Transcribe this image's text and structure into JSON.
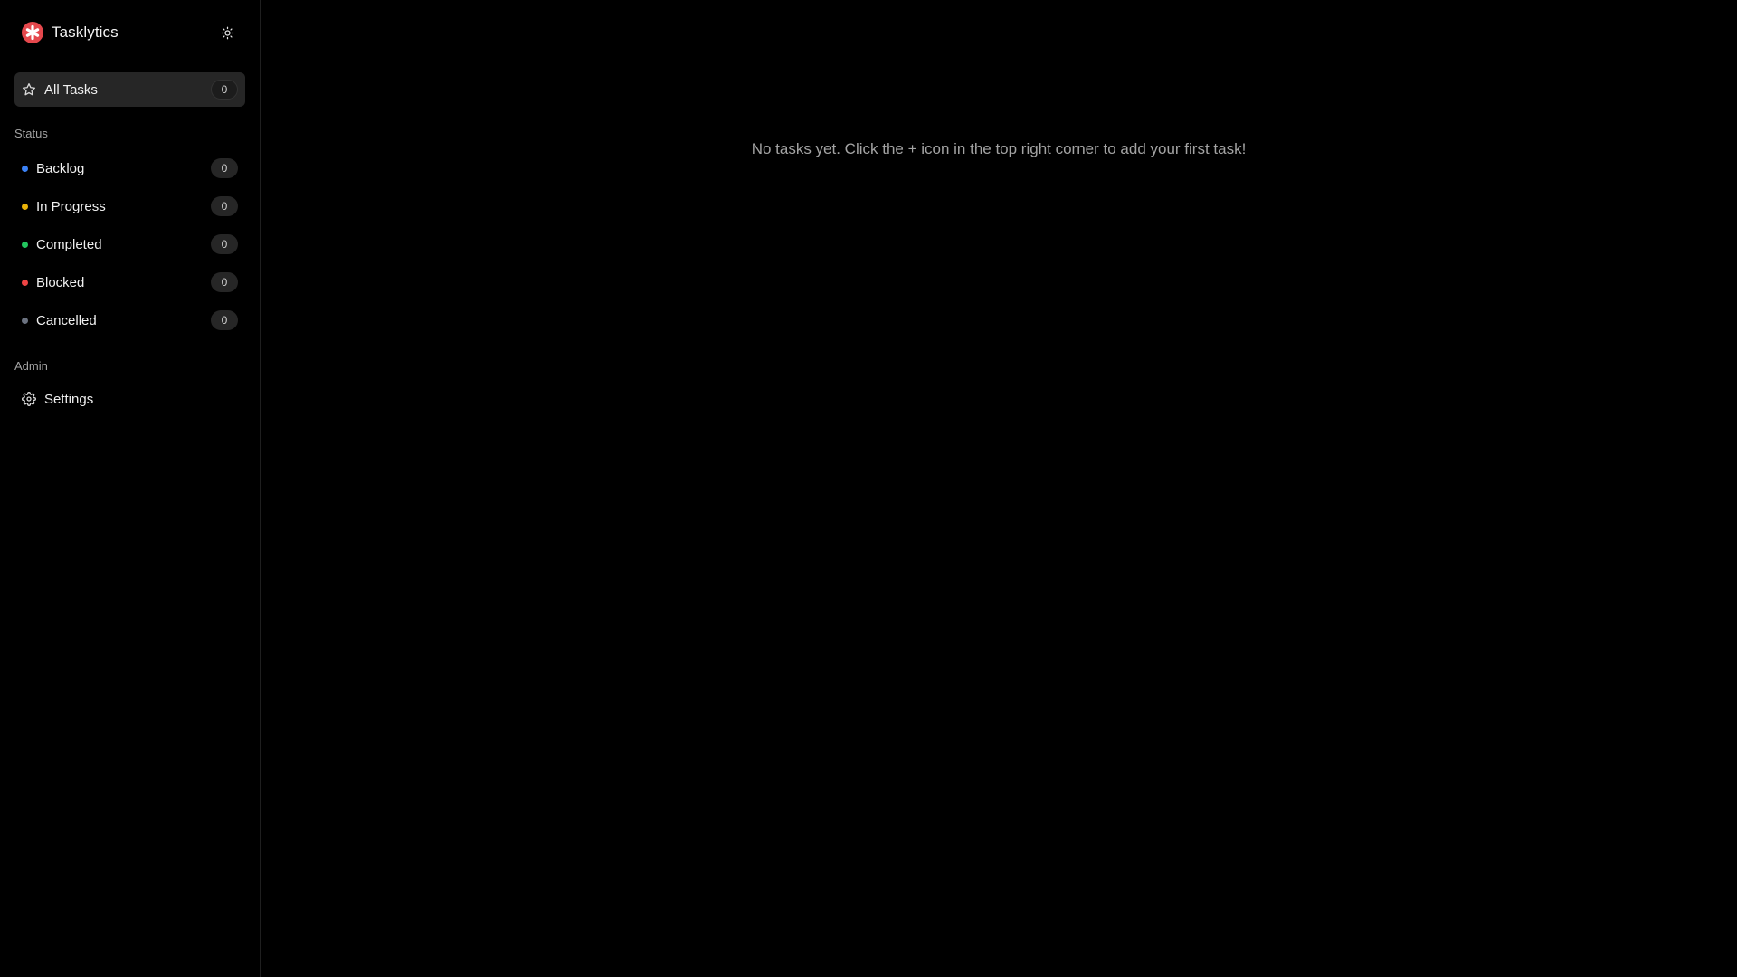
{
  "app": {
    "name": "Tasklytics",
    "logo_icon": "asterisk-logo-icon",
    "logo_color": "#e5484d",
    "theme_toggle_icon": "sun-icon"
  },
  "sidebar": {
    "all_tasks": {
      "label": "All Tasks",
      "count": "0",
      "icon": "star-icon"
    },
    "status_section_label": "Status",
    "statuses": [
      {
        "label": "Backlog",
        "count": "0",
        "color": "#3b82f6"
      },
      {
        "label": "In Progress",
        "count": "0",
        "color": "#eab308"
      },
      {
        "label": "Completed",
        "count": "0",
        "color": "#22c55e"
      },
      {
        "label": "Blocked",
        "count": "0",
        "color": "#ef4444"
      },
      {
        "label": "Cancelled",
        "count": "0",
        "color": "#6b7280"
      }
    ],
    "admin_section_label": "Admin",
    "settings": {
      "label": "Settings",
      "icon": "gear-icon"
    }
  },
  "main": {
    "empty_message": "No tasks yet. Click the + icon in the top right corner to add your first task!"
  }
}
